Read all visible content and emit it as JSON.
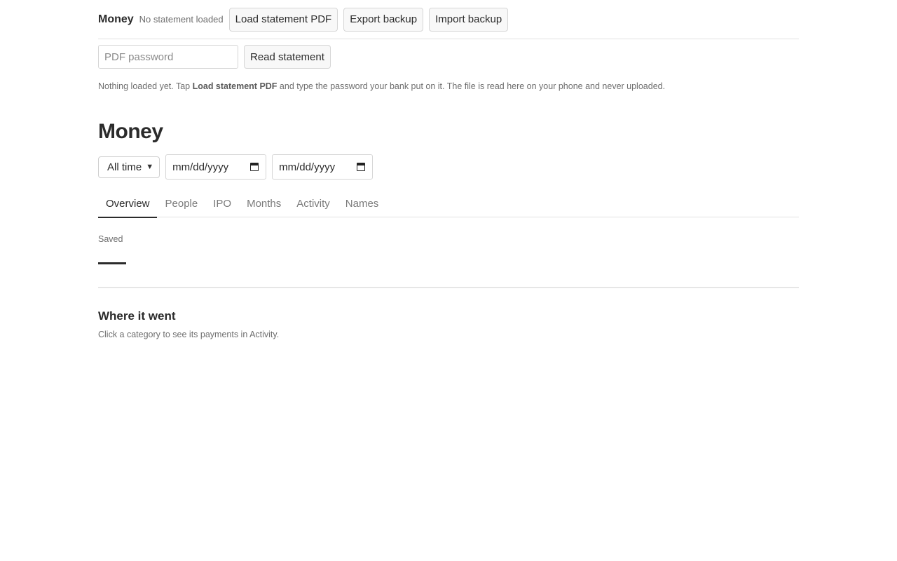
{
  "header": {
    "brand": "Money",
    "status": "No statement loaded",
    "buttons": {
      "load": "Load statement PDF",
      "export": "Export backup",
      "import": "Import backup"
    }
  },
  "password": {
    "placeholder": "PDF password",
    "read_button": "Read statement"
  },
  "hint": {
    "before": "Nothing loaded yet. Tap ",
    "bold": "Load statement PDF",
    "after": " and type the password your bank put on it. The file is read here on your phone and never uploaded."
  },
  "main": {
    "title": "Money",
    "filters": {
      "range_selected": "All time",
      "start_date_placeholder": "mm/dd/yyyy",
      "end_date_placeholder": "mm/dd/yyyy"
    },
    "tabs": [
      {
        "label": "Overview",
        "active": true
      },
      {
        "label": "People"
      },
      {
        "label": "IPO"
      },
      {
        "label": "Months"
      },
      {
        "label": "Activity"
      },
      {
        "label": "Names"
      }
    ],
    "saved_label": "Saved",
    "where": {
      "title": "Where it went",
      "hint": "Click a category to see its payments in Activity."
    }
  }
}
